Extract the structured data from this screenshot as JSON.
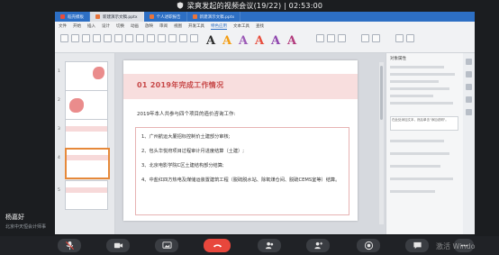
{
  "meeting": {
    "title": "梁爽发起的视频会议(19/22) | 02:53:00"
  },
  "wps": {
    "tabs": [
      {
        "label": "稻壳模板"
      },
      {
        "label": "新建演示文稿.pptx"
      },
      {
        "label": "个人述职报告"
      },
      {
        "label": "新建演示文稿.pptx"
      }
    ],
    "menu": [
      "文件",
      "开始",
      "插入",
      "设计",
      "切换",
      "动画",
      "放映",
      "审阅",
      "视图",
      "开发工具",
      "特色应用",
      "文本工具",
      "查找"
    ],
    "art_letters": [
      "A",
      "A",
      "A",
      "A",
      "A",
      "A"
    ],
    "slide_numbers": [
      "1",
      "2",
      "3",
      "4",
      "5"
    ]
  },
  "slide": {
    "heading": "01 2019年完成工作情况",
    "intro": "2019年本人共参与四个项目的造价咨询工作:",
    "bullets": [
      "1、广州航运大厦招标控制价土建部分审核;",
      "2、包头华悦府项目过程审计月进度结算（土建）;",
      "3、北京电影学院C区土建结构部分结算;",
      "4、中盐红四方热电及煤储运装置建筑工程（脱硫脱水站、除氧煤仓间、脱硫CEMS室等）结算。"
    ]
  },
  "right_pane": {
    "header": "对象属性",
    "note": "在此处添加文本，然后单击\"添加说明\"。"
  },
  "participant": {
    "name": "杨嘉好",
    "org": "北京中天恒会计师事"
  },
  "controls": {
    "buttons": [
      "mic",
      "camera",
      "share",
      "end-call",
      "participants",
      "record",
      "chat",
      "more"
    ]
  },
  "watermark": "激活 Windo"
}
